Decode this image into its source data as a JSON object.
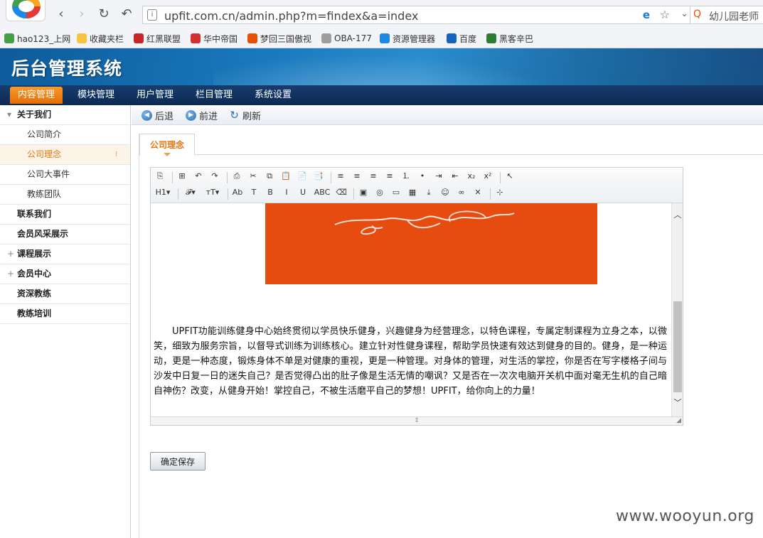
{
  "browser": {
    "url": "upfit.com.cn/admin.php?m=findex&a=index",
    "search_text": "幼儿园老师",
    "bookmarks": [
      {
        "label": "hao123_上网",
        "color": "#43a047"
      },
      {
        "label": "收藏夹栏",
        "color": "#f5c542"
      },
      {
        "label": "红黑联盟",
        "color": "#c62828"
      },
      {
        "label": "华中帝国",
        "color": "#d32f2f"
      },
      {
        "label": "梦回三国傲视",
        "color": "#e65100"
      },
      {
        "label": "OBA-177",
        "color": "#9e9e9e"
      },
      {
        "label": "资源管理器",
        "color": "#1e88e5"
      },
      {
        "label": "百度",
        "color": "#1565c0"
      },
      {
        "label": "黑客辛巴",
        "color": "#2e7d32"
      }
    ]
  },
  "header": {
    "title": "后台管理系统"
  },
  "mainnav": [
    "内容管理",
    "模块管理",
    "用户管理",
    "栏目管理",
    "系统设置"
  ],
  "sidebar": [
    {
      "label": "关于我们",
      "type": "top",
      "prefix": "▾"
    },
    {
      "label": "公司简介",
      "type": "sub"
    },
    {
      "label": "公司理念",
      "type": "sub",
      "active": true
    },
    {
      "label": "公司大事件",
      "type": "sub"
    },
    {
      "label": "教练团队",
      "type": "sub"
    },
    {
      "label": "联系我们",
      "type": "top"
    },
    {
      "label": "会员风采展示",
      "type": "top"
    },
    {
      "label": "课程展示",
      "type": "top",
      "prefix": "+"
    },
    {
      "label": "会员中心",
      "type": "top",
      "prefix": "+"
    },
    {
      "label": "资深教练",
      "type": "top"
    },
    {
      "label": "教练培训",
      "type": "top"
    }
  ],
  "toolbar": {
    "back": "后退",
    "forward": "前进",
    "refresh": "刷新"
  },
  "tab": {
    "label": "公司理念"
  },
  "editor": {
    "row1": [
      "⎘",
      "|",
      "⊞",
      "↶",
      "↷",
      "|",
      "⎙",
      "✂",
      "⧉",
      "📋",
      "📄",
      "📑",
      "|",
      "≡",
      "≡",
      "≡",
      "≡",
      "⒈",
      "•",
      "⇥",
      "⇤",
      "x₂",
      "x²",
      "|",
      "↖"
    ],
    "row2": [
      "H1▾",
      "|",
      "𝓕▾",
      "тT▾",
      "|",
      "Ab",
      "T",
      "B",
      "I",
      "U",
      "ABC",
      "⌫",
      "|",
      "▣",
      "◎",
      "▭",
      "▦",
      "⤓",
      "☺",
      "∞",
      "✕",
      "|",
      "⊹"
    ],
    "paragraph": "UPFIT功能训练健身中心始终贯彻以学员快乐健身，兴趣健身为经营理念，以特色课程，专属定制课程为立身之本，以微笑，细致为服务宗旨，以督导式训练为训练核心。建立针对性健身课程，帮助学员快速有效达到健身的目的。健身，是一种运动，更是一种态度，锻炼身体不单是对健康的重视，更是一种管理。对身体的管理，对生活的掌控，你是否在写字楼格子间与沙发中日复一日的迷失自己？是否觉得凸出的肚子像是生活无情的嘲讽？又是否在一次次电脑开关机中面对毫无生机的自己暗自神伤？改变，从健身开始！掌控自己，不被生活磨平自己的梦想！UPFIT，给你向上的力量！"
  },
  "save_label": "确定保存",
  "watermark": "www.wooyun.org"
}
